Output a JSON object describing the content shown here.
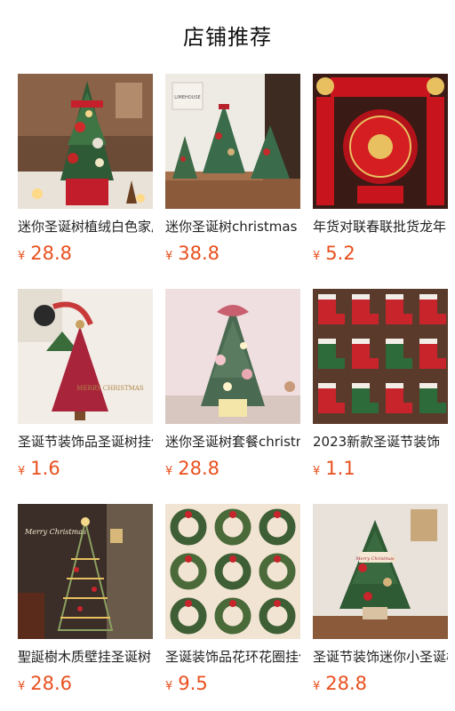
{
  "header": {
    "title": "店铺推荐"
  },
  "products": [
    {
      "name": "迷你圣诞树植绒白色家居",
      "currency": "¥",
      "price": "28.8",
      "image": "mini-christmas-tree-photo"
    },
    {
      "name": "迷你圣诞树christmas",
      "currency": "¥",
      "price": "38.8",
      "image": "christmas-trees-on-shelf-photo"
    },
    {
      "name": "年货对联春联批货龙年",
      "currency": "¥",
      "price": "5.2",
      "image": "spring-couplets-photo"
    },
    {
      "name": "圣诞节装饰品圣诞树挂件",
      "currency": "¥",
      "price": "1.6",
      "image": "felt-tree-ornament-photo"
    },
    {
      "name": "迷你圣诞树套餐christmas",
      "currency": "¥",
      "price": "28.8",
      "image": "mini-tree-set-photo"
    },
    {
      "name": "2023新款圣诞节装饰",
      "currency": "¥",
      "price": "1.1",
      "image": "christmas-stockings-photo"
    },
    {
      "name": "聖誕樹木质壁挂圣诞树",
      "currency": "¥",
      "price": "28.6",
      "image": "wall-christmas-tree-photo"
    },
    {
      "name": "圣诞装饰品花环花圈挂件",
      "currency": "¥",
      "price": "9.5",
      "image": "christmas-wreaths-photo"
    },
    {
      "name": "圣诞节装饰迷你小圣诞树",
      "currency": "¥",
      "price": "28.8",
      "image": "small-tree-merry-christmas-photo"
    }
  ],
  "image_texts": {
    "ornament_text": "MERRY CHRISTMAS",
    "wall_text": "Merry Christmas",
    "tree_sign": "Merry Christmas",
    "shelf_brand": "LIMEHOUSE"
  }
}
